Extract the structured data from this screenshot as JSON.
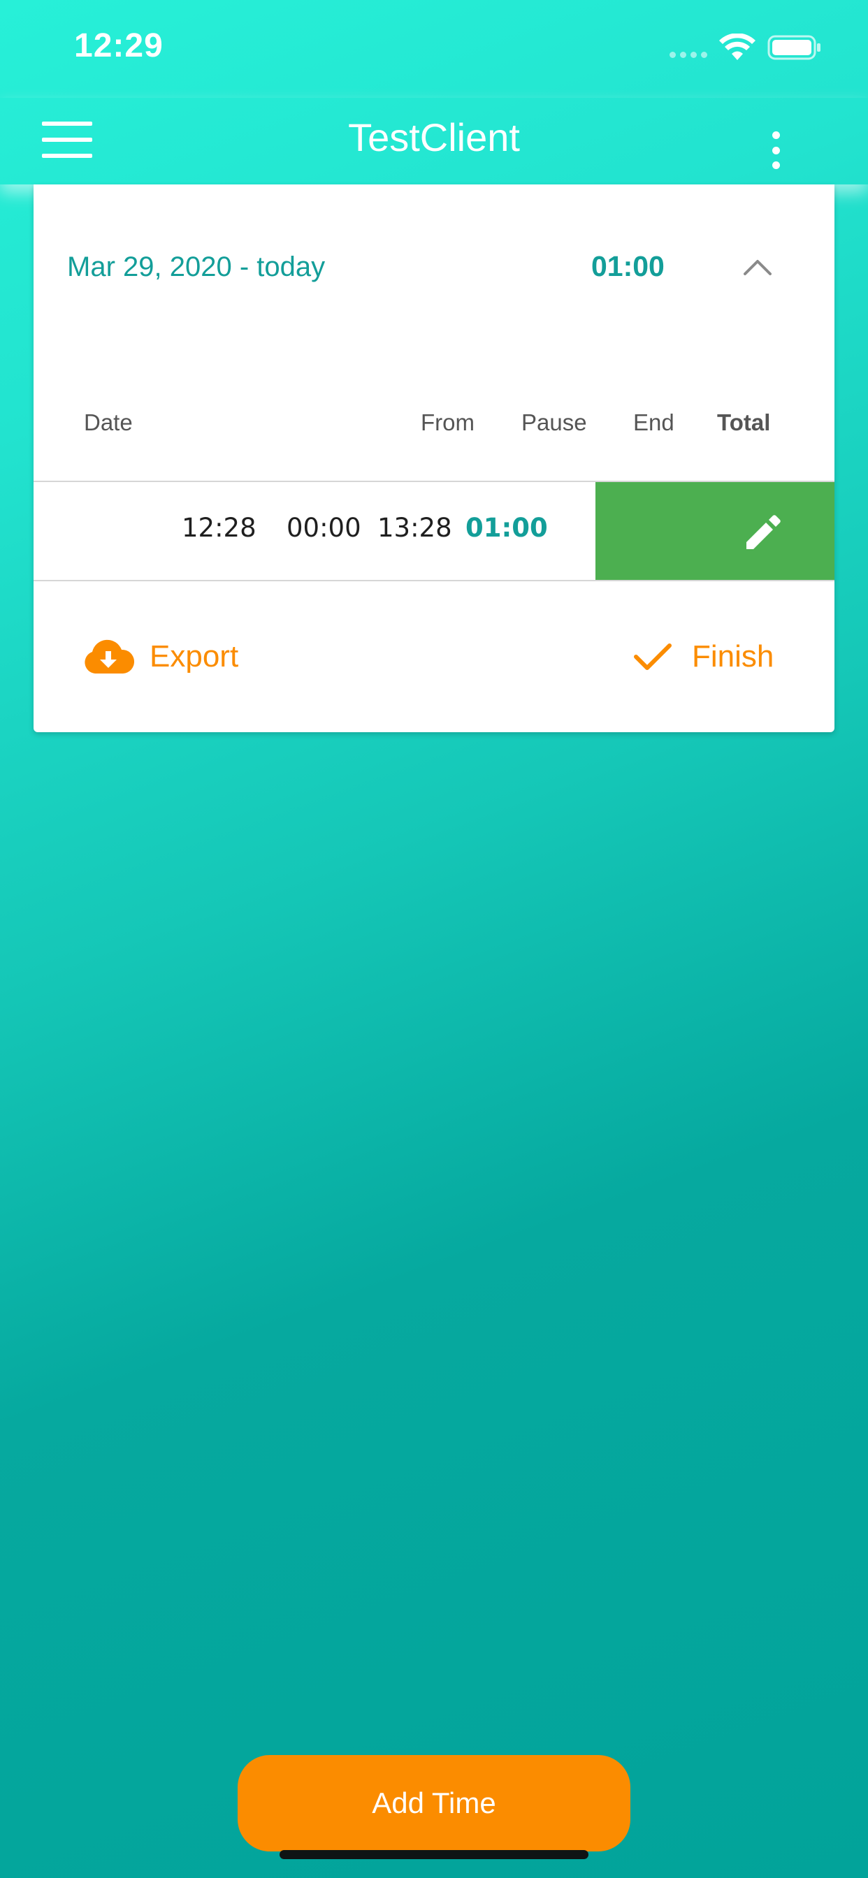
{
  "status_bar": {
    "time": "12:29",
    "icons": [
      "cellular-signal-icon",
      "wifi-icon",
      "battery-icon"
    ]
  },
  "header": {
    "title": "TestClient",
    "left_icon": "menu-icon",
    "right_icon": "more-vertical-icon"
  },
  "summary": {
    "date_range": "Mar 29, 2020 - today",
    "total": "01:00",
    "toggle_icon": "chevron-up-icon"
  },
  "table": {
    "columns": [
      "Date",
      "From",
      "Pause",
      "End",
      "Total"
    ],
    "rows": [
      {
        "date": "",
        "from": "12:28",
        "pause": "00:00",
        "end": "13:28",
        "total": "01:00",
        "swipe_action_icon": "pencil-icon"
      }
    ]
  },
  "actions": {
    "export_label": "Export",
    "export_icon": "cloud-download-icon",
    "finish_label": "Finish",
    "finish_icon": "check-icon"
  },
  "add_time_label": "Add Time",
  "colors": {
    "accent_teal": "#139e99",
    "orange": "#fb8c00",
    "edit_green": "#4caf50",
    "background_top": "#27f0d8",
    "background_bottom": "#02a39a"
  }
}
